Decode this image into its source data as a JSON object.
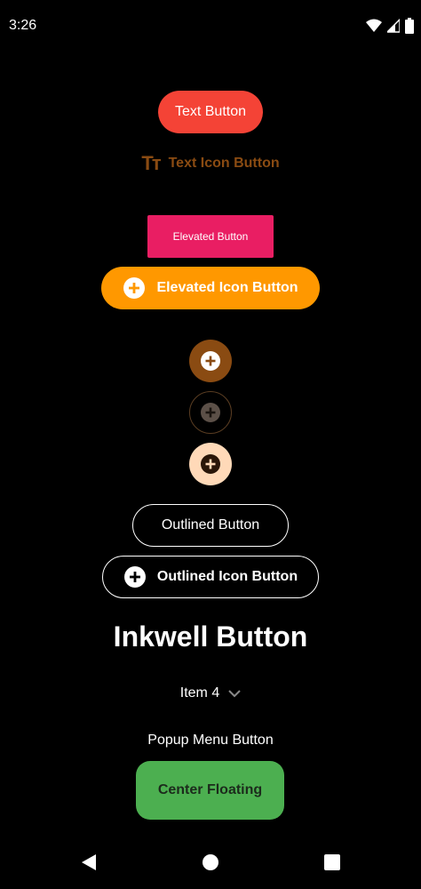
{
  "status_bar": {
    "time": "3:26",
    "icons": [
      "wifi-icon",
      "signal-icon",
      "battery-icon"
    ]
  },
  "buttons": {
    "text_button": "Text Button",
    "text_icon_button": "Text Icon Button",
    "elevated_button": "Elevated Button",
    "elevated_icon_button": "Elevated Icon Button",
    "outlined_button": "Outlined Button",
    "outlined_icon_button": "Outlined Icon Button",
    "inkwell_button": "Inkwell Button",
    "popup_menu_button": "Popup Menu Button",
    "center_floating": "Center Floating"
  },
  "dropdown": {
    "selected": "Item 4"
  },
  "icons": {
    "text_icon": "Tт",
    "add_icon": "add-circle-icon",
    "dropdown_icon": "chevron-down-icon"
  },
  "colors": {
    "text_button_bg": "#f44336",
    "text_icon_color": "#8a4b12",
    "elevated_button_bg": "#e91e63",
    "elevated_icon_button_bg": "#ff9800",
    "circle_filled": "#8a4b12",
    "circle_tonal": "#ffd9b8",
    "fab_bg": "#4caf50"
  },
  "nav_bar": [
    "back-icon",
    "home-icon",
    "recents-icon"
  ]
}
